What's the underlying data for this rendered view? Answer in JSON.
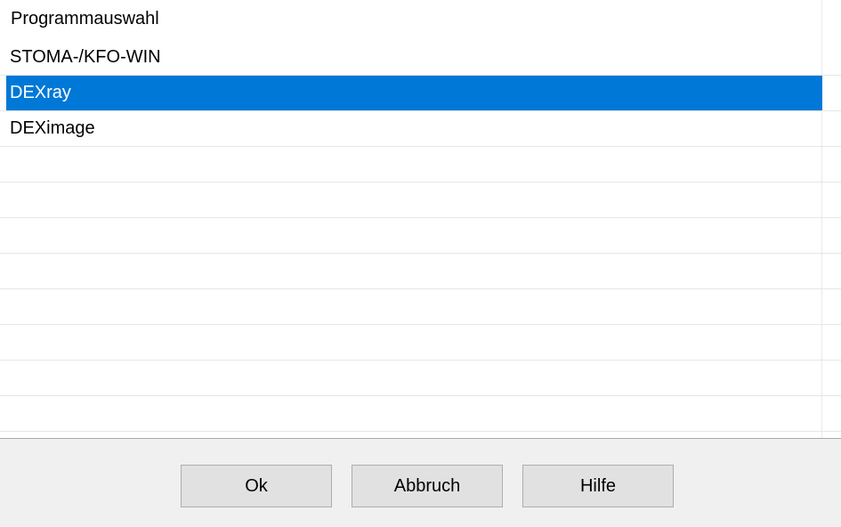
{
  "list": {
    "header": "Programmauswahl",
    "items": [
      {
        "label": "STOMA-/KFO-WIN",
        "selected": false
      },
      {
        "label": "DEXray",
        "selected": true
      },
      {
        "label": "DEXimage",
        "selected": false
      },
      {
        "label": "",
        "selected": false
      },
      {
        "label": "",
        "selected": false
      },
      {
        "label": "",
        "selected": false
      },
      {
        "label": "",
        "selected": false
      },
      {
        "label": "",
        "selected": false
      },
      {
        "label": "",
        "selected": false
      },
      {
        "label": "",
        "selected": false
      },
      {
        "label": "",
        "selected": false
      }
    ],
    "selection_color": "#0078d7"
  },
  "buttons": {
    "ok_label": "Ok",
    "cancel_label": "Abbruch",
    "help_label": "Hilfe"
  }
}
